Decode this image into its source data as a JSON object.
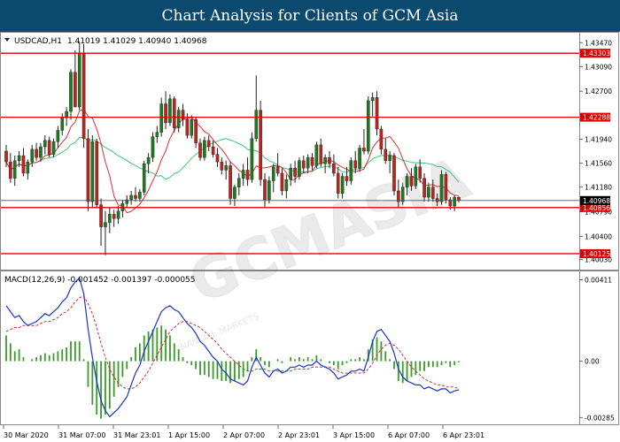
{
  "banner": {
    "title": "Chart Analysis for Clients of GCM Asia"
  },
  "watermark": {
    "brand": "GCMASIA",
    "tagline": "GLOBAL FINANCIAL MARKETS"
  },
  "colors": {
    "banner_bg": "#0b4a6e",
    "bull": "#1e7a1e",
    "bear": "#c0221e",
    "ma_fast": "#e03030",
    "ma_slow": "#3cc878",
    "level_line": "#e00000",
    "current_price_line": "#555555",
    "macd_line": "#1a33c8",
    "signal_line": "#d03030",
    "hist": "#3a9a2a"
  },
  "chart_data": [
    {
      "type": "candlestick",
      "title": "USDCAD,H1",
      "ohlc_label": "1.41019 1.41029 1.40940 1.40968",
      "ylim": [
        1.399,
        1.436
      ],
      "y_ticks": [
        "1.43470",
        "1.43090",
        "1.42700",
        "1.41940",
        "1.41560",
        "1.41180",
        "1.40790",
        "1.40400",
        "1.40030"
      ],
      "levels": [
        {
          "value": 1.43303,
          "label": "1.43303"
        },
        {
          "value": 1.42288,
          "label": "1.42288"
        },
        {
          "value": 1.40856,
          "label": "1.40856"
        },
        {
          "value": 1.40125,
          "label": "1.40125"
        }
      ],
      "current_price": {
        "value": 1.40968,
        "label": "1.40968"
      },
      "x_labels": [
        "30 Mar 2020",
        "31 Mar 07:00",
        "31 Mar 23:01",
        "1 Apr 15:00",
        "2 Apr 07:00",
        "2 Apr 23:01",
        "3 Apr 15:00",
        "6 Apr 07:00",
        "6 Apr 23:01"
      ],
      "candles": [
        [
          1.4175,
          1.4185,
          1.415,
          1.4158
        ],
        [
          1.4158,
          1.4172,
          1.4125,
          1.4132
        ],
        [
          1.4132,
          1.4168,
          1.412,
          1.416
        ],
        [
          1.416,
          1.4175,
          1.415,
          1.4168
        ],
        [
          1.4168,
          1.418,
          1.4135,
          1.414
        ],
        [
          1.414,
          1.4162,
          1.413,
          1.4158
        ],
        [
          1.4158,
          1.4185,
          1.415,
          1.4178
        ],
        [
          1.4178,
          1.4188,
          1.416,
          1.4165
        ],
        [
          1.4165,
          1.4188,
          1.4158,
          1.4182
        ],
        [
          1.4182,
          1.42,
          1.417,
          1.4192
        ],
        [
          1.4192,
          1.4198,
          1.4165,
          1.417
        ],
        [
          1.417,
          1.4195,
          1.4165,
          1.419
        ],
        [
          1.419,
          1.4215,
          1.418,
          1.4208
        ],
        [
          1.4208,
          1.4235,
          1.42,
          1.4228
        ],
        [
          1.4228,
          1.4245,
          1.4215,
          1.4238
        ],
        [
          1.4238,
          1.4305,
          1.4225,
          1.43
        ],
        [
          1.43,
          1.4335,
          1.428,
          1.4245
        ],
        [
          1.4245,
          1.4348,
          1.424,
          1.433
        ],
        [
          1.433,
          1.4345,
          1.418,
          1.4195
        ],
        [
          1.4195,
          1.421,
          1.408,
          1.4095
        ],
        [
          1.4095,
          1.42,
          1.4085,
          1.419
        ],
        [
          1.419,
          1.4195,
          1.4085,
          1.409
        ],
        [
          1.409,
          1.41,
          1.4025,
          1.4055
        ],
        [
          1.4055,
          1.408,
          1.401,
          1.4062
        ],
        [
          1.4062,
          1.4085,
          1.4045,
          1.4075
        ],
        [
          1.4075,
          1.4082,
          1.4055,
          1.4068
        ],
        [
          1.4068,
          1.4088,
          1.406,
          1.408
        ],
        [
          1.408,
          1.4098,
          1.407,
          1.4092
        ],
        [
          1.4092,
          1.4105,
          1.4085,
          1.4098
        ],
        [
          1.4098,
          1.4112,
          1.409,
          1.4105
        ],
        [
          1.4105,
          1.4118,
          1.4095,
          1.41
        ],
        [
          1.41,
          1.4115,
          1.4095,
          1.411
        ],
        [
          1.411,
          1.416,
          1.4105,
          1.4155
        ],
        [
          1.4155,
          1.4172,
          1.414,
          1.4165
        ],
        [
          1.4165,
          1.4205,
          1.4158,
          1.4198
        ],
        [
          1.4198,
          1.4215,
          1.4188,
          1.4205
        ],
        [
          1.4205,
          1.426,
          1.4198,
          1.425
        ],
        [
          1.425,
          1.427,
          1.421,
          1.422
        ],
        [
          1.422,
          1.4265,
          1.4215,
          1.4258
        ],
        [
          1.4258,
          1.4262,
          1.4205,
          1.4212
        ],
        [
          1.4212,
          1.4245,
          1.4205,
          1.424
        ],
        [
          1.424,
          1.425,
          1.4215,
          1.4225
        ],
        [
          1.4225,
          1.4235,
          1.4195,
          1.42
        ],
        [
          1.42,
          1.4232,
          1.4195,
          1.4225
        ],
        [
          1.4225,
          1.423,
          1.418,
          1.4188
        ],
        [
          1.4188,
          1.4195,
          1.416,
          1.4165
        ],
        [
          1.4165,
          1.4198,
          1.416,
          1.4192
        ],
        [
          1.4192,
          1.42,
          1.4175,
          1.4182
        ],
        [
          1.4182,
          1.4192,
          1.4165,
          1.417
        ],
        [
          1.417,
          1.418,
          1.415,
          1.4158
        ],
        [
          1.4158,
          1.4165,
          1.4138,
          1.4145
        ],
        [
          1.4145,
          1.416,
          1.413,
          1.4152
        ],
        [
          1.4152,
          1.4158,
          1.409,
          1.41
        ],
        [
          1.41,
          1.4122,
          1.4088,
          1.4118
        ],
        [
          1.4118,
          1.414,
          1.4105,
          1.4132
        ],
        [
          1.4132,
          1.4155,
          1.412,
          1.4145
        ],
        [
          1.4145,
          1.4165,
          1.412,
          1.413
        ],
        [
          1.413,
          1.4205,
          1.4125,
          1.4195
        ],
        [
          1.4195,
          1.4295,
          1.419,
          1.424
        ],
        [
          1.424,
          1.4255,
          1.412,
          1.413
        ],
        [
          1.413,
          1.414,
          1.4085,
          1.4098
        ],
        [
          1.4098,
          1.4135,
          1.4092,
          1.4128
        ],
        [
          1.4128,
          1.4155,
          1.411,
          1.415
        ],
        [
          1.415,
          1.4172,
          1.4135,
          1.414
        ],
        [
          1.414,
          1.4148,
          1.4105,
          1.4112
        ],
        [
          1.4112,
          1.4138,
          1.41,
          1.413
        ],
        [
          1.413,
          1.4155,
          1.412,
          1.4148
        ],
        [
          1.4148,
          1.416,
          1.4125,
          1.4135
        ],
        [
          1.4135,
          1.4165,
          1.413,
          1.416
        ],
        [
          1.416,
          1.4168,
          1.414,
          1.4148
        ],
        [
          1.4148,
          1.417,
          1.414,
          1.4165
        ],
        [
          1.4165,
          1.4172,
          1.4145,
          1.4152
        ],
        [
          1.4152,
          1.419,
          1.4148,
          1.4185
        ],
        [
          1.4185,
          1.4195,
          1.415,
          1.4155
        ],
        [
          1.4155,
          1.417,
          1.414,
          1.4165
        ],
        [
          1.4165,
          1.4175,
          1.4148,
          1.4155
        ],
        [
          1.4155,
          1.417,
          1.4135,
          1.414
        ],
        [
          1.414,
          1.415,
          1.41,
          1.4108
        ],
        [
          1.4108,
          1.414,
          1.41,
          1.4135
        ],
        [
          1.4135,
          1.415,
          1.412,
          1.4128
        ],
        [
          1.4128,
          1.4165,
          1.4122,
          1.416
        ],
        [
          1.416,
          1.4175,
          1.414,
          1.4148
        ],
        [
          1.4148,
          1.4185,
          1.4142,
          1.418
        ],
        [
          1.418,
          1.421,
          1.417,
          1.4175
        ],
        [
          1.4175,
          1.4262,
          1.417,
          1.4255
        ],
        [
          1.4255,
          1.4268,
          1.423,
          1.426
        ],
        [
          1.426,
          1.427,
          1.42,
          1.421
        ],
        [
          1.421,
          1.4215,
          1.417,
          1.4178
        ],
        [
          1.4178,
          1.4195,
          1.4155,
          1.416
        ],
        [
          1.416,
          1.4175,
          1.414,
          1.4168
        ],
        [
          1.4168,
          1.4172,
          1.4105,
          1.4112
        ],
        [
          1.4112,
          1.413,
          1.4085,
          1.4095
        ],
        [
          1.4095,
          1.4125,
          1.409,
          1.4118
        ],
        [
          1.4118,
          1.414,
          1.4105,
          1.4135
        ],
        [
          1.4135,
          1.4148,
          1.4112,
          1.412
        ],
        [
          1.412,
          1.4155,
          1.4115,
          1.415
        ],
        [
          1.415,
          1.4162,
          1.4125,
          1.4132
        ],
        [
          1.4132,
          1.414,
          1.4095,
          1.4102
        ],
        [
          1.4102,
          1.4125,
          1.4095,
          1.4118
        ],
        [
          1.4118,
          1.413,
          1.4095,
          1.41
        ],
        [
          1.41,
          1.4108,
          1.4088,
          1.4095
        ],
        [
          1.4095,
          1.4145,
          1.409,
          1.4138
        ],
        [
          1.4138,
          1.4142,
          1.4092,
          1.4098
        ],
        [
          1.4098,
          1.4102,
          1.4082,
          1.4088
        ],
        [
          1.4088,
          1.4105,
          1.408,
          1.4102
        ],
        [
          1.4102,
          1.4103,
          1.4094,
          1.4097
        ]
      ]
    },
    {
      "type": "macd",
      "title": "MACD(12,26,9) -0.001452 -0.001397 -0.000055",
      "ylim": [
        -0.0031,
        0.0044
      ],
      "y_ticks": [
        "0.00411",
        "0.00",
        "-0.00285"
      ],
      "macd": [
        0.0028,
        0.0025,
        0.0022,
        0.0023,
        0.002,
        0.0018,
        0.0019,
        0.002,
        0.0022,
        0.0024,
        0.0023,
        0.0025,
        0.0027,
        0.003,
        0.0032,
        0.0037,
        0.004,
        0.0042,
        0.0034,
        0.0016,
        0.0002,
        -0.001,
        -0.002,
        -0.0025,
        -0.0028,
        -0.0026,
        -0.0024,
        -0.0021,
        -0.0018,
        -0.0012,
        -0.0006,
        -0.0002,
        0.0005,
        0.001,
        0.0015,
        0.002,
        0.0025,
        0.0027,
        0.0028,
        0.0026,
        0.0025,
        0.0022,
        0.0019,
        0.0017,
        0.0014,
        0.001,
        0.0008,
        0.0005,
        0.0002,
        0.0,
        -0.0004,
        -0.0006,
        -0.0009,
        -0.001,
        -0.0011,
        -0.0012,
        -0.001,
        -0.0003,
        0.0002,
        -0.0002,
        -0.0006,
        -0.0008,
        -0.0005,
        -0.0004,
        -0.0006,
        -0.0005,
        -0.0003,
        -0.0003,
        -0.0002,
        -0.0003,
        -0.0002,
        -0.0002,
        0.0,
        -0.0002,
        -0.0003,
        -0.0004,
        -0.0006,
        -0.0009,
        -0.0008,
        -0.0007,
        -0.0005,
        -0.0005,
        -0.0004,
        -0.0005,
        0.0002,
        0.001,
        0.0015,
        0.0016,
        0.0013,
        0.001,
        0.0004,
        -0.0004,
        -0.0008,
        -0.001,
        -0.0011,
        -0.0012,
        -0.0012,
        -0.0014,
        -0.0013,
        -0.0014,
        -0.0015,
        -0.0014,
        -0.0014,
        -0.0016,
        -0.0015,
        -0.00145
      ],
      "signal": [
        0.0015,
        0.0016,
        0.0017,
        0.0017,
        0.0018,
        0.0018,
        0.0018,
        0.0018,
        0.0019,
        0.002,
        0.002,
        0.0021,
        0.0022,
        0.0024,
        0.0025,
        0.0027,
        0.003,
        0.0032,
        0.0033,
        0.0029,
        0.0024,
        0.0017,
        0.0009,
        0.0002,
        -0.0004,
        -0.0008,
        -0.0011,
        -0.0013,
        -0.0014,
        -0.0014,
        -0.0013,
        -0.0011,
        -0.0008,
        -0.0005,
        -0.0001,
        0.0003,
        0.0007,
        0.0011,
        0.0015,
        0.0017,
        0.0019,
        0.002,
        0.002,
        0.0019,
        0.0018,
        0.0017,
        0.0015,
        0.0013,
        0.0011,
        0.0009,
        0.0006,
        0.0004,
        0.0002,
        0.0,
        -0.0002,
        -0.0004,
        -0.0005,
        -0.0005,
        -0.0004,
        -0.0004,
        -0.0004,
        -0.0005,
        -0.0005,
        -0.0005,
        -0.0005,
        -0.0005,
        -0.0005,
        -0.0004,
        -0.0004,
        -0.0004,
        -0.0004,
        -0.0003,
        -0.0003,
        -0.0003,
        -0.0003,
        -0.0003,
        -0.0004,
        -0.0005,
        -0.0006,
        -0.0006,
        -0.0006,
        -0.0006,
        -0.0006,
        -0.0006,
        -0.0004,
        -0.0001,
        0.0003,
        0.0006,
        0.0008,
        0.0009,
        0.0008,
        0.0006,
        0.0003,
        0.0,
        -0.0003,
        -0.0005,
        -0.0007,
        -0.0009,
        -0.001,
        -0.0011,
        -0.0012,
        -0.0012,
        -0.0013,
        -0.0013,
        -0.0013,
        -0.0014
      ],
      "histogram": [
        0.0013,
        0.0009,
        0.0005,
        0.0006,
        0.0002,
        0.0,
        0.0001,
        0.0002,
        0.0003,
        0.0004,
        0.0003,
        0.0004,
        0.0005,
        0.0006,
        0.0007,
        0.001,
        0.001,
        0.001,
        0.0001,
        -0.0013,
        -0.0022,
        -0.0027,
        -0.0029,
        -0.0027,
        -0.0024,
        -0.0018,
        -0.0013,
        -0.0008,
        -0.0004,
        0.0002,
        0.0007,
        0.0009,
        0.0013,
        0.0015,
        0.0016,
        0.0017,
        0.0018,
        0.0016,
        0.0013,
        0.0009,
        0.0006,
        0.0002,
        -0.0001,
        -0.0002,
        -0.0004,
        -0.0007,
        -0.0007,
        -0.0008,
        -0.0009,
        -0.0009,
        -0.001,
        -0.001,
        -0.0011,
        -0.001,
        -0.0009,
        -0.0008,
        -0.0005,
        0.0002,
        0.0006,
        0.0002,
        -0.0002,
        -0.0003,
        0.0,
        0.0001,
        -0.0001,
        0.0,
        0.0002,
        0.0001,
        0.0002,
        0.0001,
        0.0002,
        0.0001,
        0.0003,
        0.0001,
        0.0,
        -0.0001,
        -0.0002,
        -0.0004,
        -0.0002,
        -0.0001,
        0.0001,
        0.0001,
        0.0002,
        0.0001,
        0.0006,
        0.0011,
        0.0012,
        0.001,
        0.0005,
        0.0001,
        -0.0004,
        -0.001,
        -0.0011,
        -0.001,
        -0.0008,
        -0.0007,
        -0.0005,
        -0.0005,
        -0.0003,
        -0.0003,
        -0.0003,
        -0.0002,
        -0.0001,
        -0.0003,
        -0.0002,
        -6e-05
      ]
    }
  ]
}
